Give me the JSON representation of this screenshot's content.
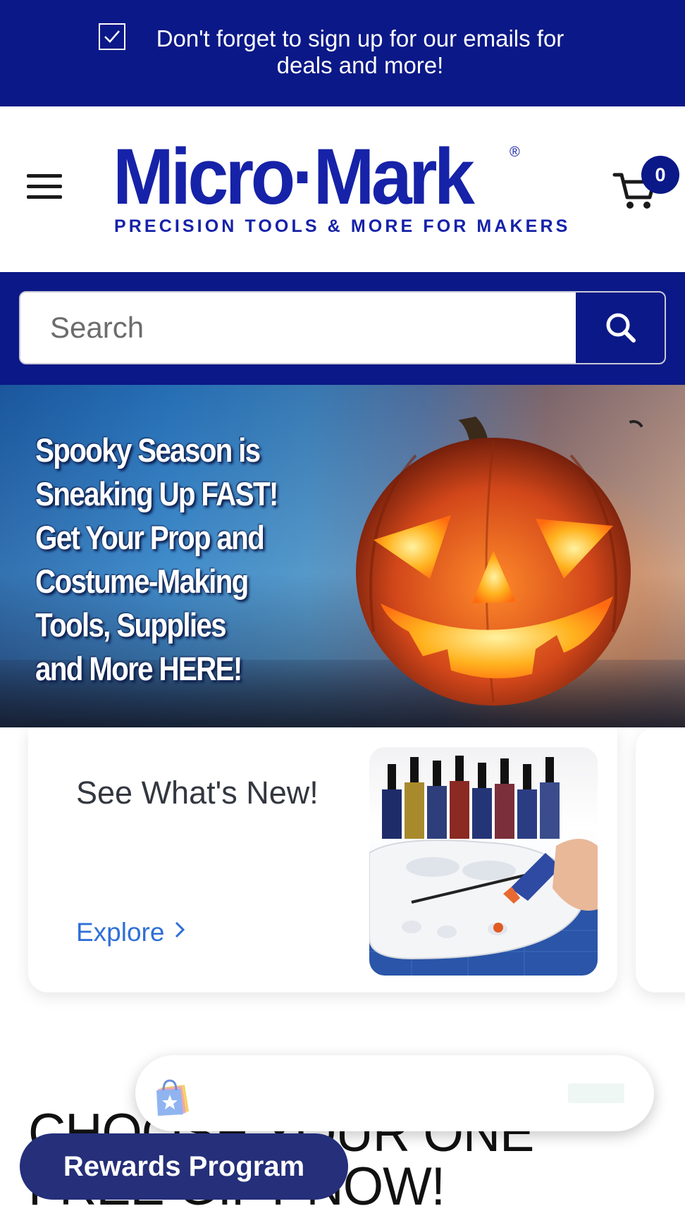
{
  "announcement": {
    "text": "Don't forget to sign up for our emails for deals and more!",
    "icon": "checkbox-icon"
  },
  "header": {
    "logo_text": "Micro·Mark",
    "logo_registered": "®",
    "logo_tagline": "PRECISION TOOLS & MORE FOR MAKERS",
    "cart_count": "0",
    "menu_icon": "hamburger-icon",
    "cart_icon": "cart-icon"
  },
  "search": {
    "placeholder": "Search",
    "value": "",
    "button_icon": "search-icon"
  },
  "hero": {
    "lines": [
      "Spooky Season is",
      "Sneaking Up FAST!",
      "Get Your Prop and",
      "Costume-Making",
      "Tools, Supplies",
      "and More HERE!"
    ]
  },
  "card": {
    "title": "See What's New!",
    "link": "Explore",
    "link_icon": "chevron-right-icon"
  },
  "free_gift": {
    "heading_line1": "CHOOSE YOUR ONE",
    "heading_line2": "FREE GIFT NOW!"
  },
  "rewards": {
    "button_label": "Rewards Program",
    "widget_icon": "shopping-bag-star-icon"
  },
  "colors": {
    "brand_navy": "#0b1887",
    "logo_blue": "#1622a8",
    "link_blue": "#2f6fd8",
    "rewards_button": "#252f7a"
  }
}
